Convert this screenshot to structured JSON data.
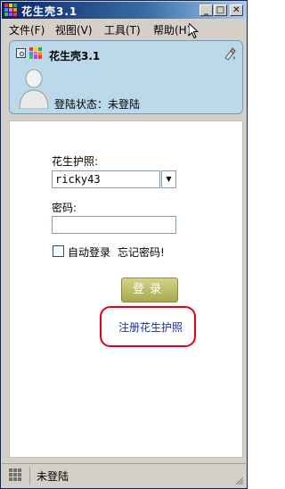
{
  "window": {
    "title": "花生壳3.1"
  },
  "title_buttons": {
    "minimize": "_",
    "maximize": "□",
    "close": "✕"
  },
  "menu": {
    "items": [
      "文件(F)",
      "视图(V)",
      "工具(T)",
      "帮助(H)"
    ]
  },
  "header": {
    "app_name": "花生壳3.1",
    "login_status": "登陆状态：未登陆"
  },
  "form": {
    "passport_label": "花生护照:",
    "passport_value": "ricky43",
    "password_label": "密码:",
    "password_value": "",
    "auto_login_label": "自动登录",
    "forgot_password": "忘记密码!",
    "login_button": "登录",
    "register_link": "注册花生护照"
  },
  "statusbar": {
    "text": "未登陆"
  },
  "colors": {
    "title_start": "#0a246a",
    "header_bg": "#bcd9eb",
    "button": "#b8b95a",
    "link": "#1a2e9c",
    "highlight": "#e3001b"
  }
}
